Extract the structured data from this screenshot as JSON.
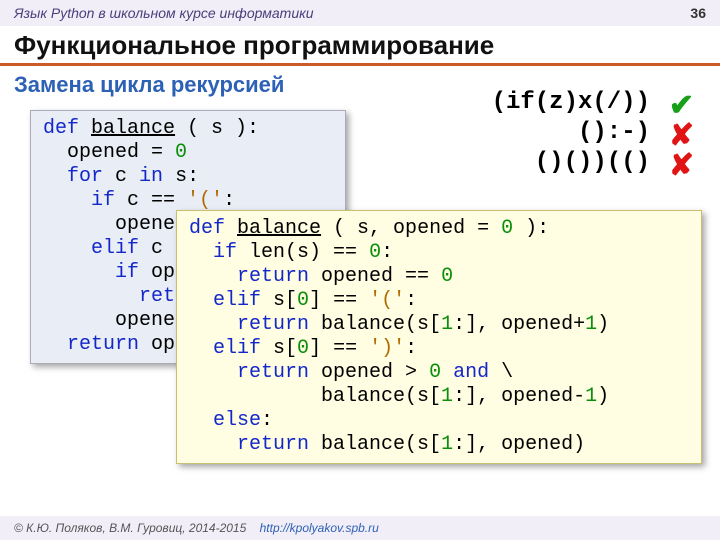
{
  "topbar": {
    "course": "Язык Python в школьном курсе информатики",
    "page": "36"
  },
  "title": "Функциональное программирование",
  "subtitle": "Замена цикла рекурсией",
  "examples": {
    "e1": "(if(z)x(/))",
    "m1": "✔",
    "e2": "():-)",
    "m2": "✘",
    "e3": "()())(()",
    "m3": "✘"
  },
  "code1": {
    "l1a": "def",
    "l1b": " ",
    "l1c": "balance",
    "l1d": " ( s ):",
    "l2a": "  opened = ",
    "l2b": "0",
    "l3a": "  ",
    "l3b": "for",
    "l3c": " c ",
    "l3d": "in",
    "l3e": " s:",
    "l4a": "    ",
    "l4b": "if",
    "l4c": " c == ",
    "l4d": "'('",
    "l4e": ":",
    "l5": "      opened",
    "l6a": "    ",
    "l6b": "elif",
    "l6c": " c =",
    "l7a": "      ",
    "l7b": "if",
    "l7c": " ope",
    "l8a": "        ",
    "l8b": "retu",
    "l9": "      opened",
    "l10a": "  ",
    "l10b": "return",
    "l10c": " ope"
  },
  "code2": {
    "l1a": "def",
    "l1b": " ",
    "l1c": "balance",
    "l1d": " ( s, opened = ",
    "l1e": "0",
    "l1f": " ):",
    "l2a": "  ",
    "l2b": "if",
    "l2c": " len(s) == ",
    "l2d": "0",
    "l2e": ":",
    "l3a": "    ",
    "l3b": "return",
    "l3c": " opened == ",
    "l3d": "0",
    "l4a": "  ",
    "l4b": "elif",
    "l4c": " s[",
    "l4d": "0",
    "l4e": "] == ",
    "l4f": "'('",
    "l4g": ":",
    "l5a": "    ",
    "l5b": "return",
    "l5c": " balance(s[",
    "l5d": "1",
    "l5e": ":], opened+",
    "l5f": "1",
    "l5g": ")",
    "l6a": "  ",
    "l6b": "elif",
    "l6c": " s[",
    "l6d": "0",
    "l6e": "] == ",
    "l6f": "')'",
    "l6g": ":",
    "l7a": "    ",
    "l7b": "return",
    "l7c": " opened > ",
    "l7d": "0",
    "l7e": " ",
    "l7f": "and",
    "l7g": " \\",
    "l8a": "           balance(s[",
    "l8b": "1",
    "l8c": ":], opened-",
    "l8d": "1",
    "l8e": ")",
    "l9a": "  ",
    "l9b": "else",
    "l9c": ":",
    "l10a": "    ",
    "l10b": "return",
    "l10c": " balance(s[",
    "l10d": "1",
    "l10e": ":], opened)"
  },
  "footer": {
    "copyright": "© К.Ю. Поляков, В.М. Гуровиц, 2014-2015",
    "url": "http://kpolyakov.spb.ru"
  }
}
